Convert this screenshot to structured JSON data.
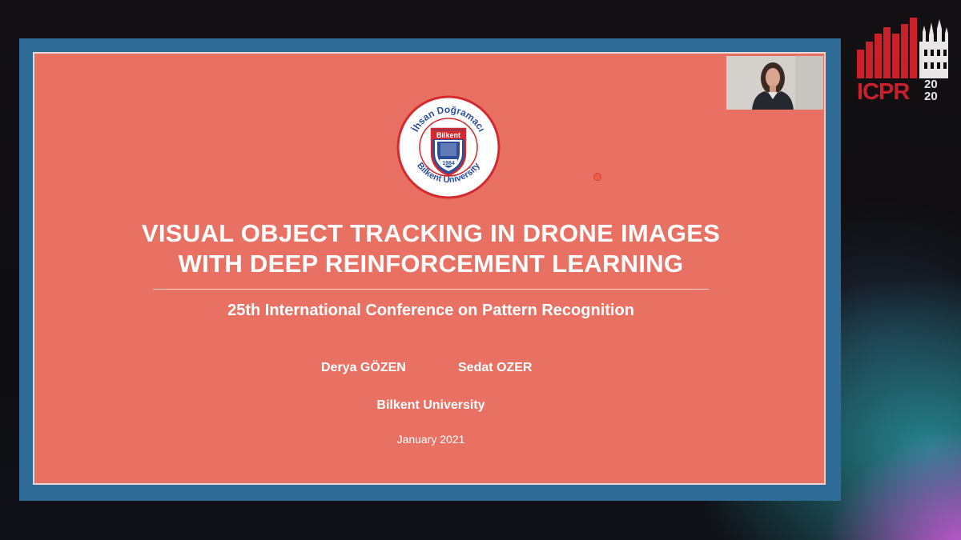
{
  "slide": {
    "title_line1": "VISUAL OBJECT TRACKING IN DRONE IMAGES",
    "title_line2": "WITH DEEP REINFORCEMENT LEARNING",
    "conference": "25th International Conference on Pattern Recognition",
    "authors": [
      "Derya GÖZEN",
      "Sedat OZER"
    ],
    "affiliation": "Bilkent University",
    "date": "January 2021",
    "logo": {
      "top_text": "İhsan Doğramacı",
      "badge_text": "Bilkent",
      "year": "1984",
      "bottom_text": "Bilkent University"
    }
  },
  "conference_logo": {
    "text": "ICPR",
    "year_top": "20",
    "year_bottom": "20"
  },
  "colors": {
    "slide_background": "#e87163",
    "frame": "#2e6b96",
    "logo_red": "#d42a2e",
    "logo_blue": "#2b4f9e",
    "icpr_red": "#c9202a"
  }
}
